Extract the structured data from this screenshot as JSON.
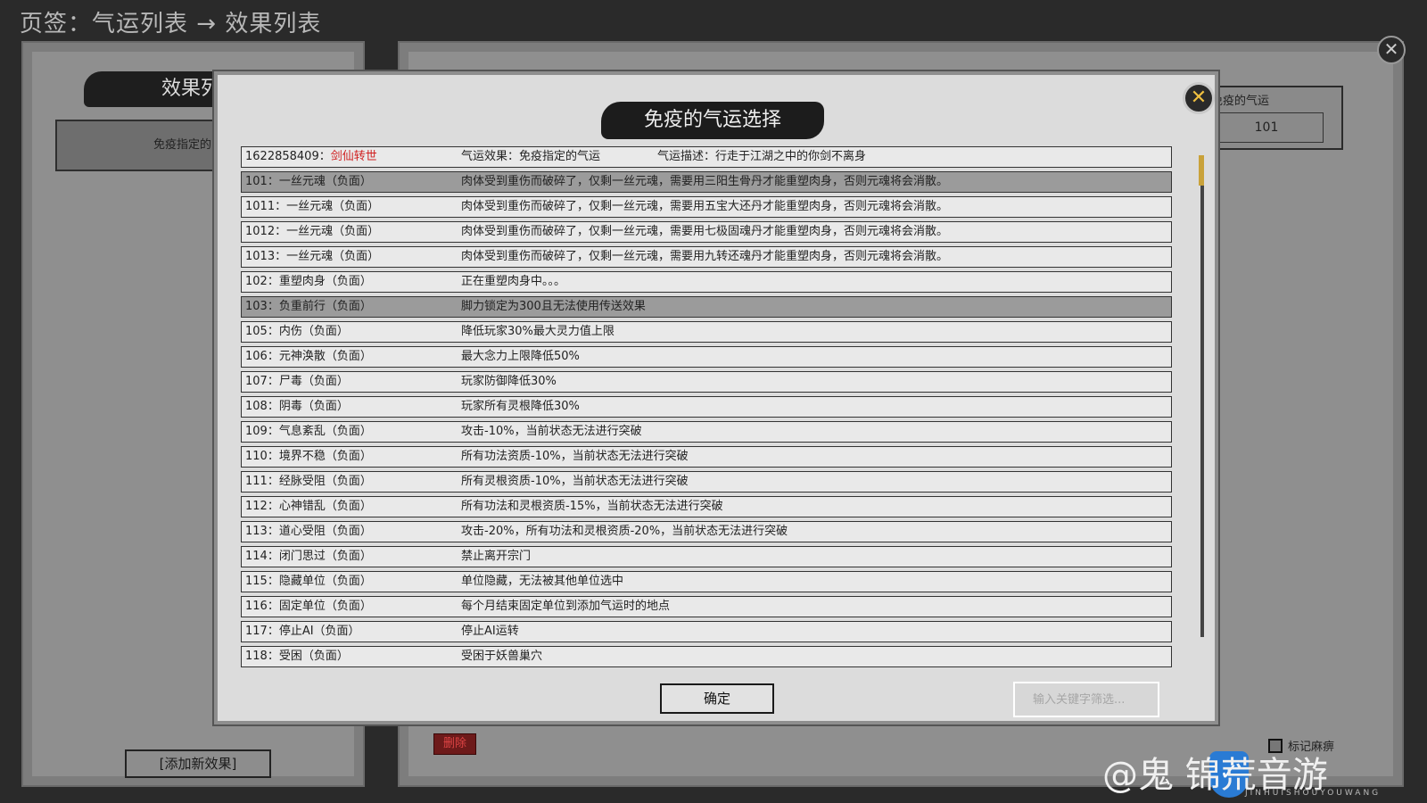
{
  "breadcrumb": "页签：气运列表 → 效果列表",
  "left_panel": {
    "title": "效果列",
    "item_label": "免疫指定的",
    "add_button": "[添加新效果]"
  },
  "right_panel": {
    "field_label": "免疫的气运",
    "field_value": "101",
    "delete_button": "删除",
    "mark_label": "标记麻痹"
  },
  "modal": {
    "title": "免疫的气运选择",
    "header_row": {
      "id": "1622858409：",
      "name": "剑仙转世",
      "effect": "气运效果：免疫指定的气运",
      "desc": "气运描述：行走于江湖之中的你剑不离身"
    },
    "rows": [
      {
        "name": "101：一丝元魂（负面）",
        "desc": "肉体受到重伤而破碎了，仅剩一丝元魂，需要用三阳生骨丹才能重塑肉身，否则元魂将会消散。",
        "highlighted": true
      },
      {
        "name": "1011：一丝元魂（负面）",
        "desc": "肉体受到重伤而破碎了，仅剩一丝元魂，需要用五宝大还丹才能重塑肉身，否则元魂将会消散。",
        "highlighted": false
      },
      {
        "name": "1012：一丝元魂（负面）",
        "desc": "肉体受到重伤而破碎了，仅剩一丝元魂，需要用七极固魂丹才能重塑肉身，否则元魂将会消散。",
        "highlighted": false
      },
      {
        "name": "1013：一丝元魂（负面）",
        "desc": "肉体受到重伤而破碎了，仅剩一丝元魂，需要用九转还魂丹才能重塑肉身，否则元魂将会消散。",
        "highlighted": false
      },
      {
        "name": "102：重塑肉身（负面）",
        "desc": "正在重塑肉身中。。。",
        "highlighted": false
      },
      {
        "name": "103：负重前行（负面）",
        "desc": "脚力锁定为300且无法使用传送效果",
        "highlighted": true
      },
      {
        "name": "105：内伤（负面）",
        "desc": "降低玩家30%最大灵力值上限",
        "highlighted": false
      },
      {
        "name": "106：元神涣散（负面）",
        "desc": "最大念力上限降低50%",
        "highlighted": false
      },
      {
        "name": "107：尸毒（负面）",
        "desc": "玩家防御降低30%",
        "highlighted": false
      },
      {
        "name": "108：阴毒（负面）",
        "desc": "玩家所有灵根降低30%",
        "highlighted": false
      },
      {
        "name": "109：气息紊乱（负面）",
        "desc": "攻击-10%，当前状态无法进行突破",
        "highlighted": false
      },
      {
        "name": "110：境界不稳（负面）",
        "desc": "所有功法资质-10%，当前状态无法进行突破",
        "highlighted": false
      },
      {
        "name": "111：经脉受阻（负面）",
        "desc": "所有灵根资质-10%，当前状态无法进行突破",
        "highlighted": false
      },
      {
        "name": "112：心神错乱（负面）",
        "desc": "所有功法和灵根资质-15%，当前状态无法进行突破",
        "highlighted": false
      },
      {
        "name": "113：道心受阻（负面）",
        "desc": "攻击-20%，所有功法和灵根资质-20%，当前状态无法进行突破",
        "highlighted": false
      },
      {
        "name": "114：闭门思过（负面）",
        "desc": "禁止离开宗门",
        "highlighted": false
      },
      {
        "name": "115：隐藏单位（负面）",
        "desc": "单位隐藏，无法被其他单位选中",
        "highlighted": false
      },
      {
        "name": "116：固定单位（负面）",
        "desc": "每个月结束固定单位到添加气运时的地点",
        "highlighted": false
      },
      {
        "name": "117：停止AI（负面）",
        "desc": "停止AI运转",
        "highlighted": false
      },
      {
        "name": "118：受困（负面）",
        "desc": "受困于妖兽巢穴",
        "highlighted": false
      }
    ],
    "ok_button": "确定",
    "filter_placeholder": "输入关键字筛选..."
  },
  "watermark": {
    "text": "@鬼",
    "text2": "锦荒音游",
    "sub": "JINHUISHOUYOUWANG"
  },
  "colors": {
    "highlight_row": "#9b9b9b",
    "name_red": "#d02020",
    "scroll_thumb": "#c9a23a"
  }
}
